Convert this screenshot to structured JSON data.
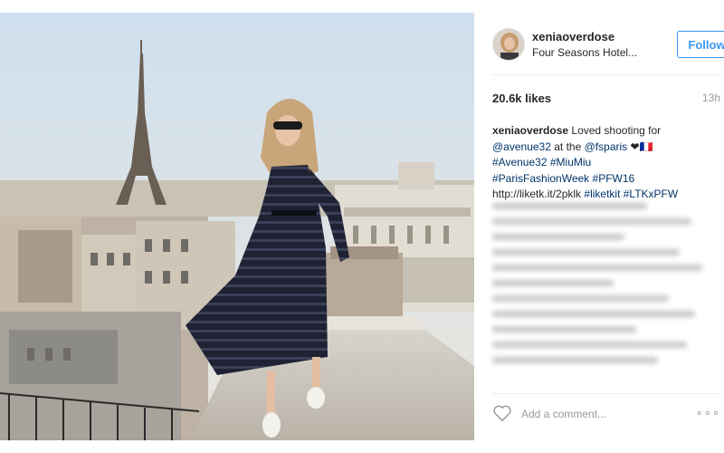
{
  "post": {
    "username": "xeniaoverdose",
    "location": "Four Seasons Hotel...",
    "follow_label": "Follow",
    "likes": "20.6k likes",
    "time": "13h",
    "caption": {
      "author": "xeniaoverdose",
      "text_1": "Loved shooting for",
      "mention_1": "@avenue32",
      "text_2": "at the",
      "mention_2": "@fsparis",
      "emoji": "❤🇫🇷",
      "hashtag_1": "#Avenue32",
      "hashtag_2": "#MiuMiu",
      "hashtag_3": "#ParisFashionWeek",
      "hashtag_4": "#PFW16",
      "link": "http://liketk.it/2pklk",
      "hashtag_5": "#liketkit",
      "hashtag_6": "#LTKxPFW"
    },
    "comment_placeholder": "Add a comment...",
    "more_label": "∘∘∘"
  },
  "icons": {
    "like": "heart-icon",
    "options": "more-options-icon"
  },
  "colors": {
    "follow_blue": "#3897f0",
    "hashtag_blue": "#003569",
    "border": "#efefef"
  }
}
